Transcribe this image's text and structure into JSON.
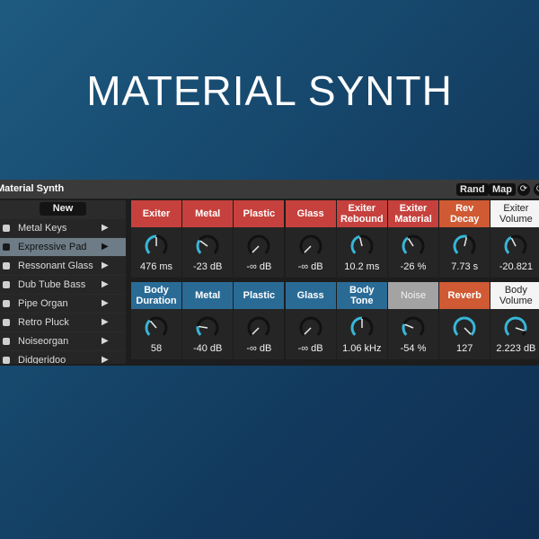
{
  "hero": {
    "title": "MATERIAL SYNTH"
  },
  "device": {
    "title": "Material Synth",
    "rand_label": "Rand",
    "map_label": "Map"
  },
  "browser": {
    "new_label": "New",
    "presets": [
      {
        "label": "Metal Keys",
        "active": false
      },
      {
        "label": "Expressive Pad",
        "active": true
      },
      {
        "label": "Ressonant Glass",
        "active": false
      },
      {
        "label": "Dub Tube Bass",
        "active": false
      },
      {
        "label": "Pipe Organ",
        "active": false
      },
      {
        "label": "Retro Pluck",
        "active": false
      },
      {
        "label": "Noiseorgan",
        "active": false
      },
      {
        "label": "Didgeridoo",
        "active": false
      }
    ]
  },
  "colors": {
    "red": "#c6413d",
    "blue": "#2a6b96",
    "orange": "#cf5a33",
    "knob_accent": "#38b6d8",
    "panel": "#252525"
  },
  "rows": [
    [
      {
        "label": "Exiter",
        "value": "476 ms",
        "color": "red",
        "level": 0.5
      },
      {
        "label": "Metal",
        "value": "-23 dB",
        "color": "red",
        "level": 0.3
      },
      {
        "label": "Plastic",
        "value": "-∞ dB",
        "color": "red",
        "level": 0.0
      },
      {
        "label": "Glass",
        "value": "-∞ dB",
        "color": "red",
        "level": 0.0
      },
      {
        "label": "Exiter\nRebound",
        "value": "10.2 ms",
        "color": "red",
        "level": 0.45
      },
      {
        "label": "Exiter\nMaterial",
        "value": "-26 %",
        "color": "red",
        "level": 0.38
      },
      {
        "label": "Rev\nDecay",
        "value": "7.73 s",
        "color": "orange",
        "level": 0.55
      },
      {
        "label": "Exiter\nVolume",
        "value": "-20.821",
        "color": "white",
        "level": 0.4
      }
    ],
    [
      {
        "label": "Body\nDuration",
        "value": "58",
        "color": "blue",
        "level": 0.35
      },
      {
        "label": "Metal",
        "value": "-40 dB",
        "color": "blue",
        "level": 0.2
      },
      {
        "label": "Plastic",
        "value": "-∞ dB",
        "color": "blue",
        "level": 0.0
      },
      {
        "label": "Glass",
        "value": "-∞ dB",
        "color": "blue",
        "level": 0.0
      },
      {
        "label": "Body\nTone",
        "value": "1.06 kHz",
        "color": "blue",
        "level": 0.5
      },
      {
        "label": "Noise",
        "value": "-54 %",
        "color": "grey",
        "level": 0.25
      },
      {
        "label": "Reverb",
        "value": "127",
        "color": "orange",
        "level": 1.0
      },
      {
        "label": "Body\nVolume",
        "value": "2.223 dB",
        "color": "white",
        "level": 0.9
      }
    ]
  ]
}
